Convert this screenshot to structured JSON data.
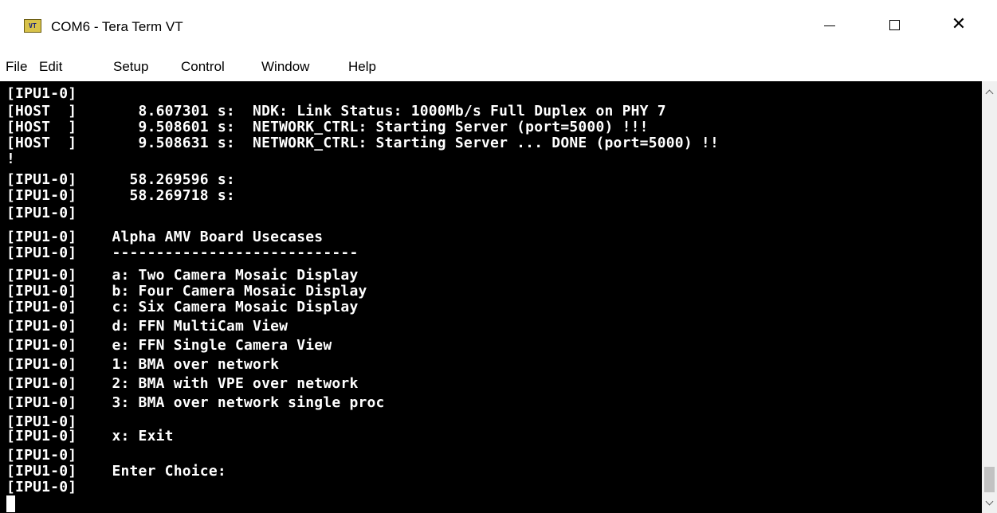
{
  "window": {
    "title": "COM6 - Tera Term VT",
    "icon": "teraterm-vt-icon",
    "icon_text": "VT",
    "controls": [
      "minimize-icon",
      "maximize-icon",
      "close-icon"
    ],
    "close_glyph": "✕"
  },
  "menu": [
    "File",
    "Edit",
    "Setup",
    "Control",
    "Window",
    "Help"
  ],
  "terminal": {
    "background": "#000000",
    "foreground": "#ffffff",
    "lines": [
      "[IPU1-0]",
      "[HOST  ]       8.607301 s:  NDK: Link Status: 1000Mb/s Full Duplex on PHY 7",
      "[HOST  ]       9.508601 s:  NETWORK_CTRL: Starting Server (port=5000) !!!",
      "[HOST  ]       9.508631 s:  NETWORK_CTRL: Starting Server ... DONE (port=5000) !!",
      "!",
      "[IPU1-0]      58.269596 s:",
      "[IPU1-0]      58.269718 s:",
      "[IPU1-0]",
      "[IPU1-0]    Alpha AMV Board Usecases",
      "[IPU1-0]    ----------------------------",
      "[IPU1-0]    a: Two Camera Mosaic Display",
      "[IPU1-0]    b: Four Camera Mosaic Display",
      "[IPU1-0]    c: Six Camera Mosaic Display",
      "[IPU1-0]    d: FFN MultiCam View",
      "[IPU1-0]    e: FFN Single Camera View",
      "[IPU1-0]    1: BMA over network",
      "[IPU1-0]    2: BMA with VPE over network",
      "[IPU1-0]    3: BMA over network single proc",
      "[IPU1-0]",
      "[IPU1-0]    x: Exit",
      "[IPU1-0]",
      "[IPU1-0]    Enter Choice:",
      "[IPU1-0]"
    ]
  },
  "scrollbar": {
    "up_icon": "scroll-up-arrow-icon",
    "down_icon": "scroll-down-arrow-icon"
  }
}
